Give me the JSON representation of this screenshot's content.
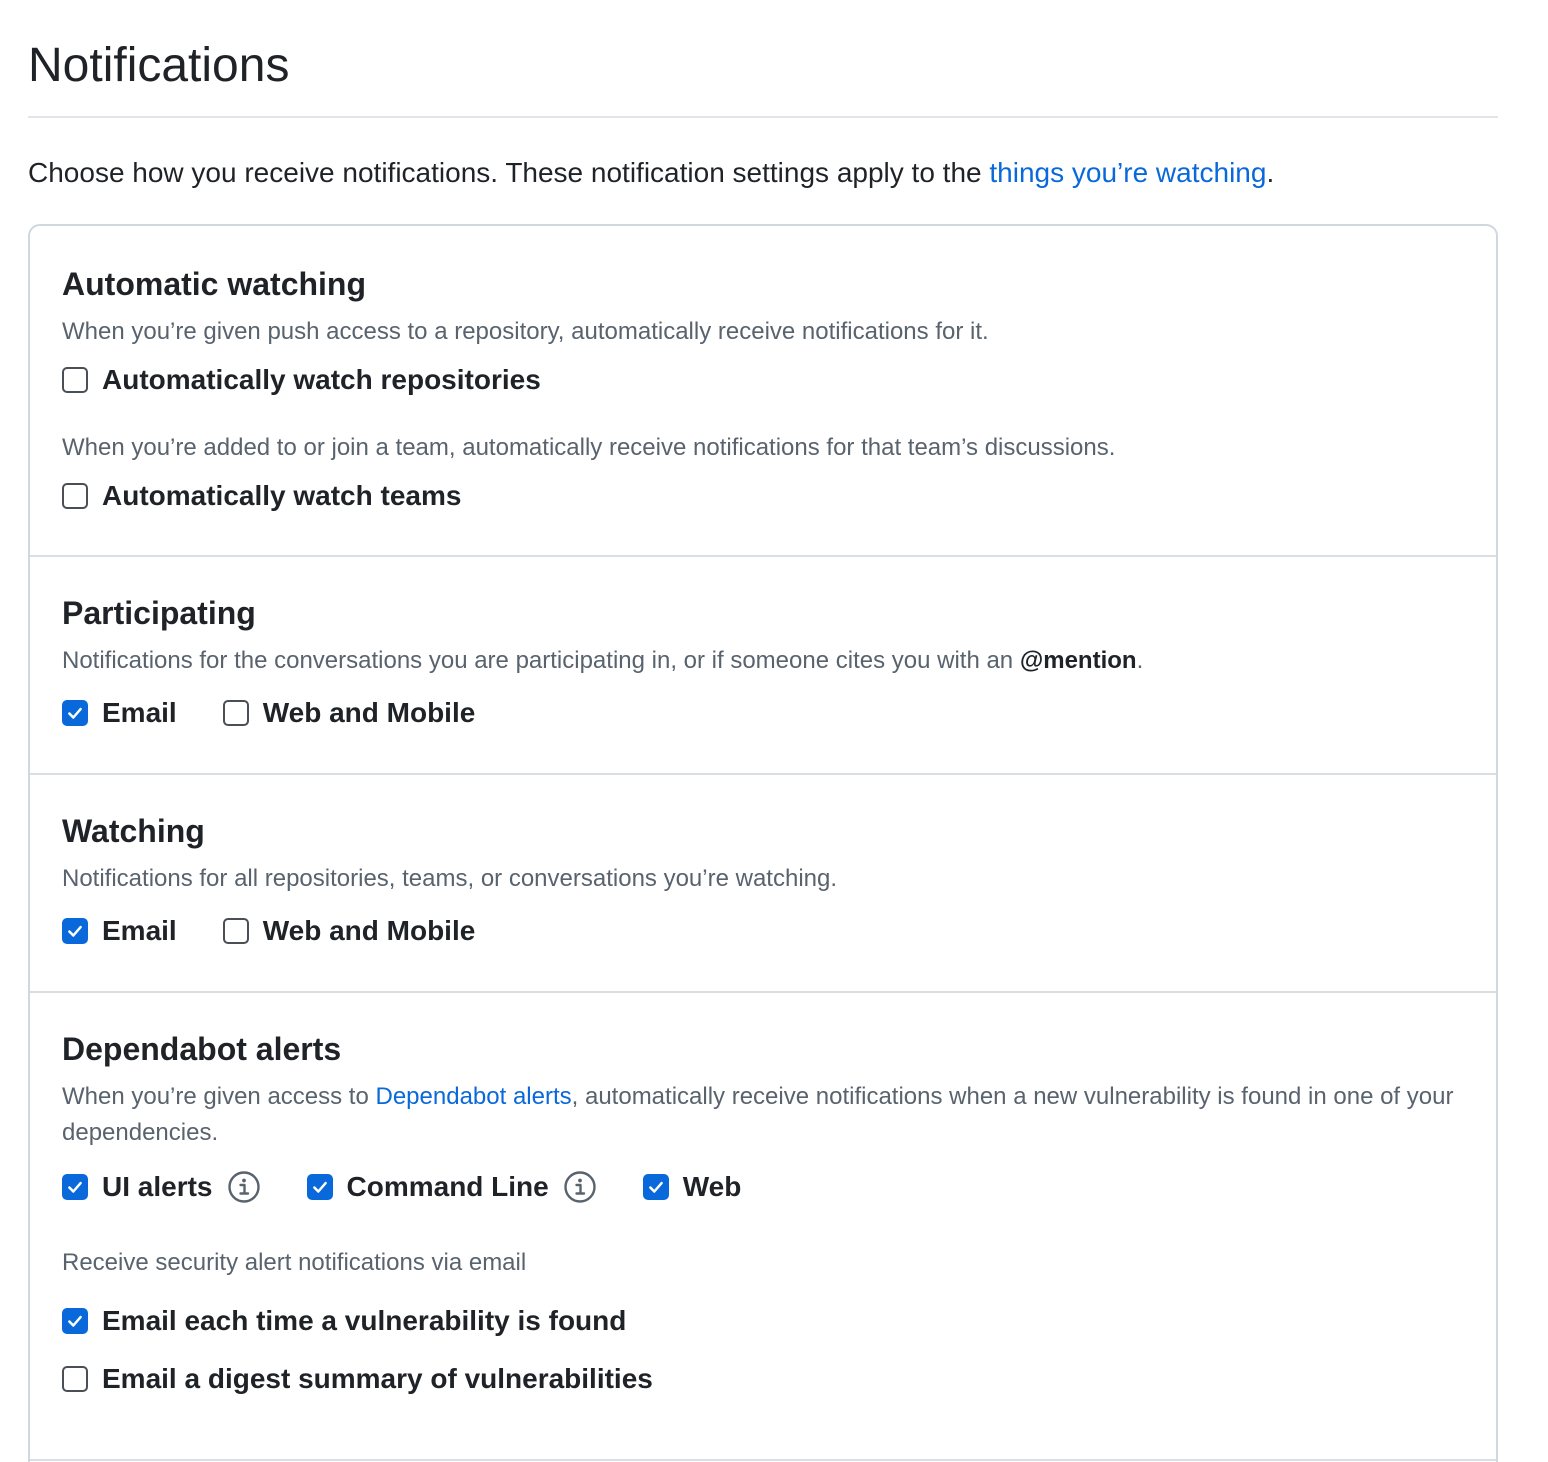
{
  "header": {
    "title": "Notifications",
    "intro_text": "Choose how you receive notifications. These notification settings apply to the ",
    "intro_link": "things you’re watching",
    "intro_end": "."
  },
  "colors": {
    "link": "#0969da",
    "checkbox_checked": "#0969da",
    "border": "#d0d7de",
    "muted_text": "#59636e"
  },
  "sections": {
    "automatic_watching": {
      "title": "Automatic watching",
      "desc_repos": "When you’re given push access to a repository, automatically receive notifications for it.",
      "repos_checkbox": {
        "label": "Automatically watch repositories",
        "checked": false
      },
      "desc_teams": "When you’re added to or join a team, automatically receive notifications for that team’s discussions.",
      "teams_checkbox": {
        "label": "Automatically watch teams",
        "checked": false
      }
    },
    "participating": {
      "title": "Participating",
      "desc": "Notifications for the conversations you are participating in, or if someone cites you with an ",
      "desc_bold": "@mention",
      "desc_end": ".",
      "email": {
        "label": "Email",
        "checked": true
      },
      "web_mobile": {
        "label": "Web and Mobile",
        "checked": false
      }
    },
    "watching": {
      "title": "Watching",
      "desc": "Notifications for all repositories, teams, or conversations you’re watching.",
      "email": {
        "label": "Email",
        "checked": true
      },
      "web_mobile": {
        "label": "Web and Mobile",
        "checked": false
      }
    },
    "dependabot": {
      "title": "Dependabot alerts",
      "desc_start": "When you’re given access to ",
      "desc_link": "Dependabot alerts",
      "desc_end": ", automatically receive notifications when a new vulnerability is found in one of your dependencies.",
      "ui_alerts": {
        "label": "UI alerts",
        "checked": true,
        "icon": "info-icon"
      },
      "command_line": {
        "label": "Command Line",
        "checked": true,
        "icon": "info-icon"
      },
      "web": {
        "label": "Web",
        "checked": true
      },
      "email_desc": "Receive security alert notifications via email",
      "email_each": {
        "label": "Email each time a vulnerability is found",
        "checked": true
      },
      "email_digest": {
        "label": "Email a digest summary of vulnerabilities",
        "checked": false
      }
    }
  }
}
